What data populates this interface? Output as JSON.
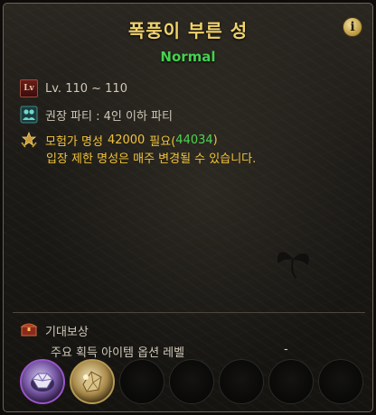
{
  "dungeon": {
    "name": "폭풍이 부른 성",
    "difficulty": "Normal"
  },
  "info_button_label": "i",
  "requirements": {
    "level_badge": "Lv",
    "level_text": "Lv. 110 ~ 110",
    "party_text": "권장 파티 : 4인 이하 파티",
    "fame_prefix": "모험가 명성",
    "fame_required": "42000",
    "fame_required_suffix": "필요(",
    "fame_current": "44034",
    "fame_close": ")",
    "fame_note": "입장 제한 명성은 매주 변경될 수 있습니다."
  },
  "rewards": {
    "title": "기대보상",
    "subtitle": "주요 획득 아이템 옵션 레벨",
    "option_level": "-",
    "slots": [
      {
        "icon": "purple-gem-item-icon",
        "filled": true
      },
      {
        "icon": "gold-material-item-icon",
        "filled": true
      },
      {
        "icon": "empty-slot",
        "filled": false
      },
      {
        "icon": "empty-slot",
        "filled": false
      },
      {
        "icon": "empty-slot",
        "filled": false
      },
      {
        "icon": "empty-slot",
        "filled": false
      },
      {
        "icon": "empty-slot",
        "filled": false
      }
    ]
  },
  "colors": {
    "title": "#f0d36a",
    "difficulty": "#45d24f",
    "fame": "#f0c23a",
    "fame_current": "#4fd34f",
    "rare_border": "#9a55c8"
  }
}
